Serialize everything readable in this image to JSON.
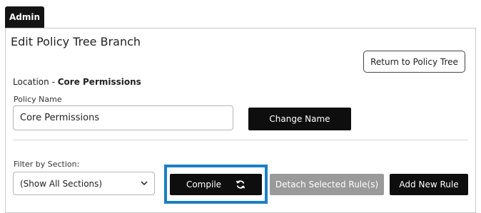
{
  "tab": {
    "label": "Admin"
  },
  "panel": {
    "title": "Edit Policy Tree Branch"
  },
  "return_button": {
    "label": "Return to Policy Tree"
  },
  "location": {
    "label": "Location - ",
    "value": "Core Permissions"
  },
  "policy_name": {
    "label": "Policy Name",
    "value": "Core Permissions"
  },
  "change_name_button": {
    "label": "Change Name"
  },
  "filter": {
    "label": "Filter by Section:",
    "selected": "(Show All Sections)"
  },
  "compile_button": {
    "label": "Compile",
    "icon": "refresh-icon"
  },
  "detach_button": {
    "label": "Detach Selected Rule(s)"
  },
  "add_rule_button": {
    "label": "Add New Rule"
  },
  "colors": {
    "highlight": "#1a7fc4",
    "dark_button": "#0e0e0e",
    "disabled_button": "#9a9a9a"
  }
}
